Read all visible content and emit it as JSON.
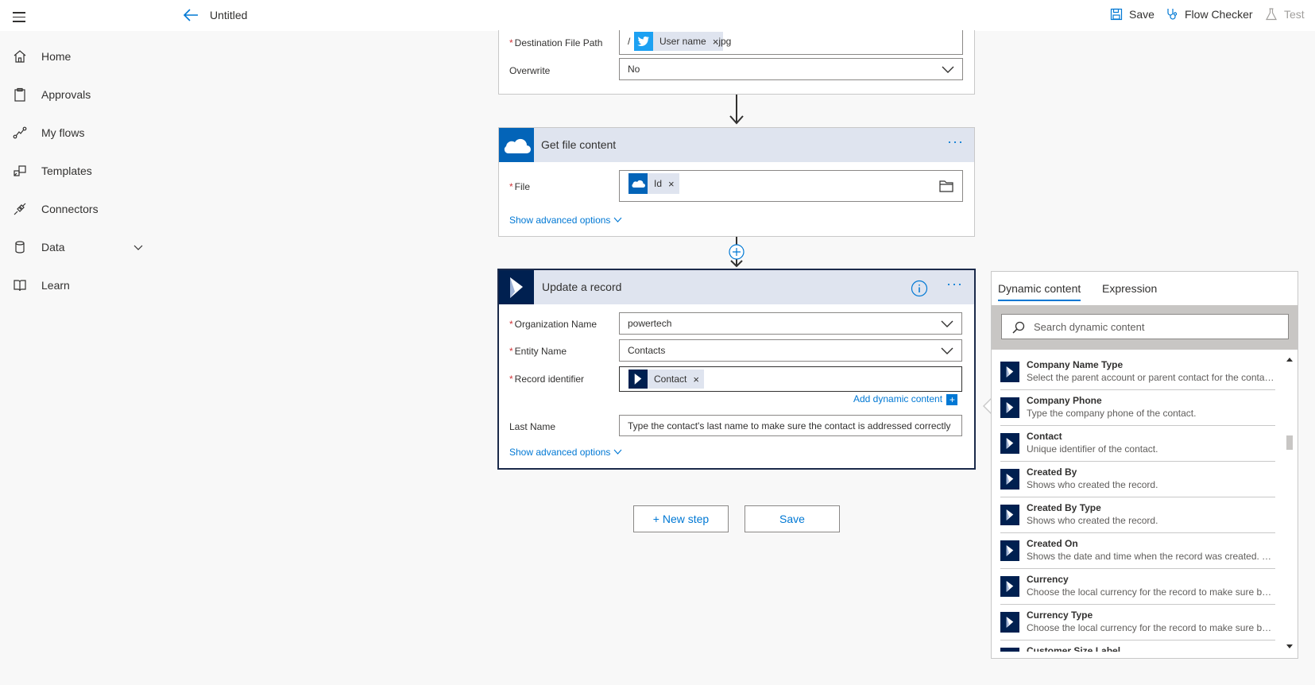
{
  "topbar": {
    "title": "Untitled",
    "save_label": "Save",
    "flow_checker_label": "Flow Checker",
    "test_label": "Test"
  },
  "sidebar": {
    "items": [
      {
        "label": "Home",
        "icon": "home-icon"
      },
      {
        "label": "Approvals",
        "icon": "clipboard-icon"
      },
      {
        "label": "My flows",
        "icon": "flow-icon"
      },
      {
        "label": "Templates",
        "icon": "templates-icon"
      },
      {
        "label": "Connectors",
        "icon": "plug-icon"
      },
      {
        "label": "Data",
        "icon": "database-icon"
      },
      {
        "label": "Learn",
        "icon": "book-icon"
      }
    ]
  },
  "create_file_card": {
    "dest_label": "Destination File Path",
    "dest_prefix": "/",
    "dest_token": "User name",
    "dest_suffix": ".jpg",
    "overwrite_label": "Overwrite",
    "overwrite_value": "No"
  },
  "get_file_card": {
    "title": "Get file content",
    "file_label": "File",
    "file_token": "Id",
    "advanced_link": "Show advanced options"
  },
  "update_card": {
    "title": "Update a record",
    "org_label": "Organization Name",
    "org_value": "powertech",
    "entity_label": "Entity Name",
    "entity_value": "Contacts",
    "record_label": "Record identifier",
    "record_token": "Contact",
    "add_dynamic_link": "Add dynamic content",
    "lastname_label": "Last Name",
    "lastname_placeholder": "Type the contact's last name to make sure the contact is addressed correctly",
    "advanced_link": "Show advanced options"
  },
  "actions": {
    "new_step_label": "+ New step",
    "save_label": "Save"
  },
  "dynamic_panel": {
    "tab_dynamic": "Dynamic content",
    "tab_expression": "Expression",
    "search_placeholder": "Search dynamic content",
    "items": [
      {
        "name": "Company Name Type",
        "desc": "Select the parent account or parent contact for the contact to provide a quick link to additional details"
      },
      {
        "name": "Company Phone",
        "desc": "Type the company phone of the contact."
      },
      {
        "name": "Contact",
        "desc": "Unique identifier of the contact."
      },
      {
        "name": "Created By",
        "desc": "Shows who created the record."
      },
      {
        "name": "Created By Type",
        "desc": "Shows who created the record."
      },
      {
        "name": "Created On",
        "desc": "Shows the date and time when the record was created. The date and time are displayed"
      },
      {
        "name": "Currency",
        "desc": "Choose the local currency for the record to make sure budgets are reported in the correct currency"
      },
      {
        "name": "Currency Type",
        "desc": "Choose the local currency for the record to make sure budgets are reported in the correct currency"
      },
      {
        "name": "Customer Size Label",
        "desc": ""
      }
    ]
  },
  "colors": {
    "accent": "#0078d4",
    "dynamics_icon": "#002050",
    "card_header": "#dfe4ef",
    "required": "#d13438"
  }
}
